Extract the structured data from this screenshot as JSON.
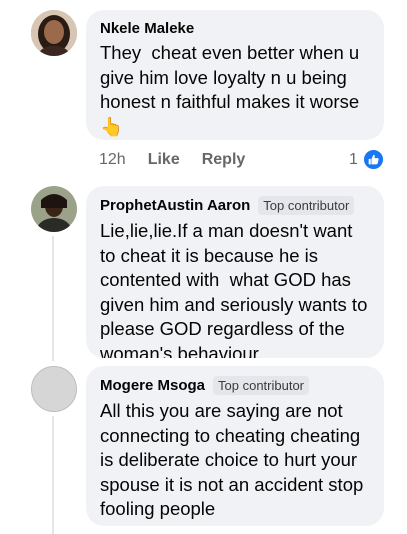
{
  "comments": [
    {
      "author": "Nkele Maleke",
      "text": "They  cheat even better when u give him love loyalty n u being honest n faithful makes it worse 👆",
      "meta": {
        "time": "12h",
        "like_label": "Like",
        "reply_label": "Reply",
        "reaction_count": "1"
      }
    },
    {
      "author": "ProphetAustin Aaron",
      "badge": "Top contributor",
      "text": "Lie,lie,lie.If a man doesn't want to cheat it is because he is contented with  what GOD has given him and seriously wants to please GOD regardless of the woman's behaviour."
    },
    {
      "author": "Mogere Msoga",
      "badge": "Top contributor",
      "text": "All this you are saying are not connecting to cheating cheating is deliberate choice to hurt your spouse it is not an accident stop fooling people"
    }
  ],
  "colors": {
    "like_blue": "#1877f2",
    "bubble_bg": "#f0f2f5",
    "badge_bg": "#e4e6eb"
  }
}
